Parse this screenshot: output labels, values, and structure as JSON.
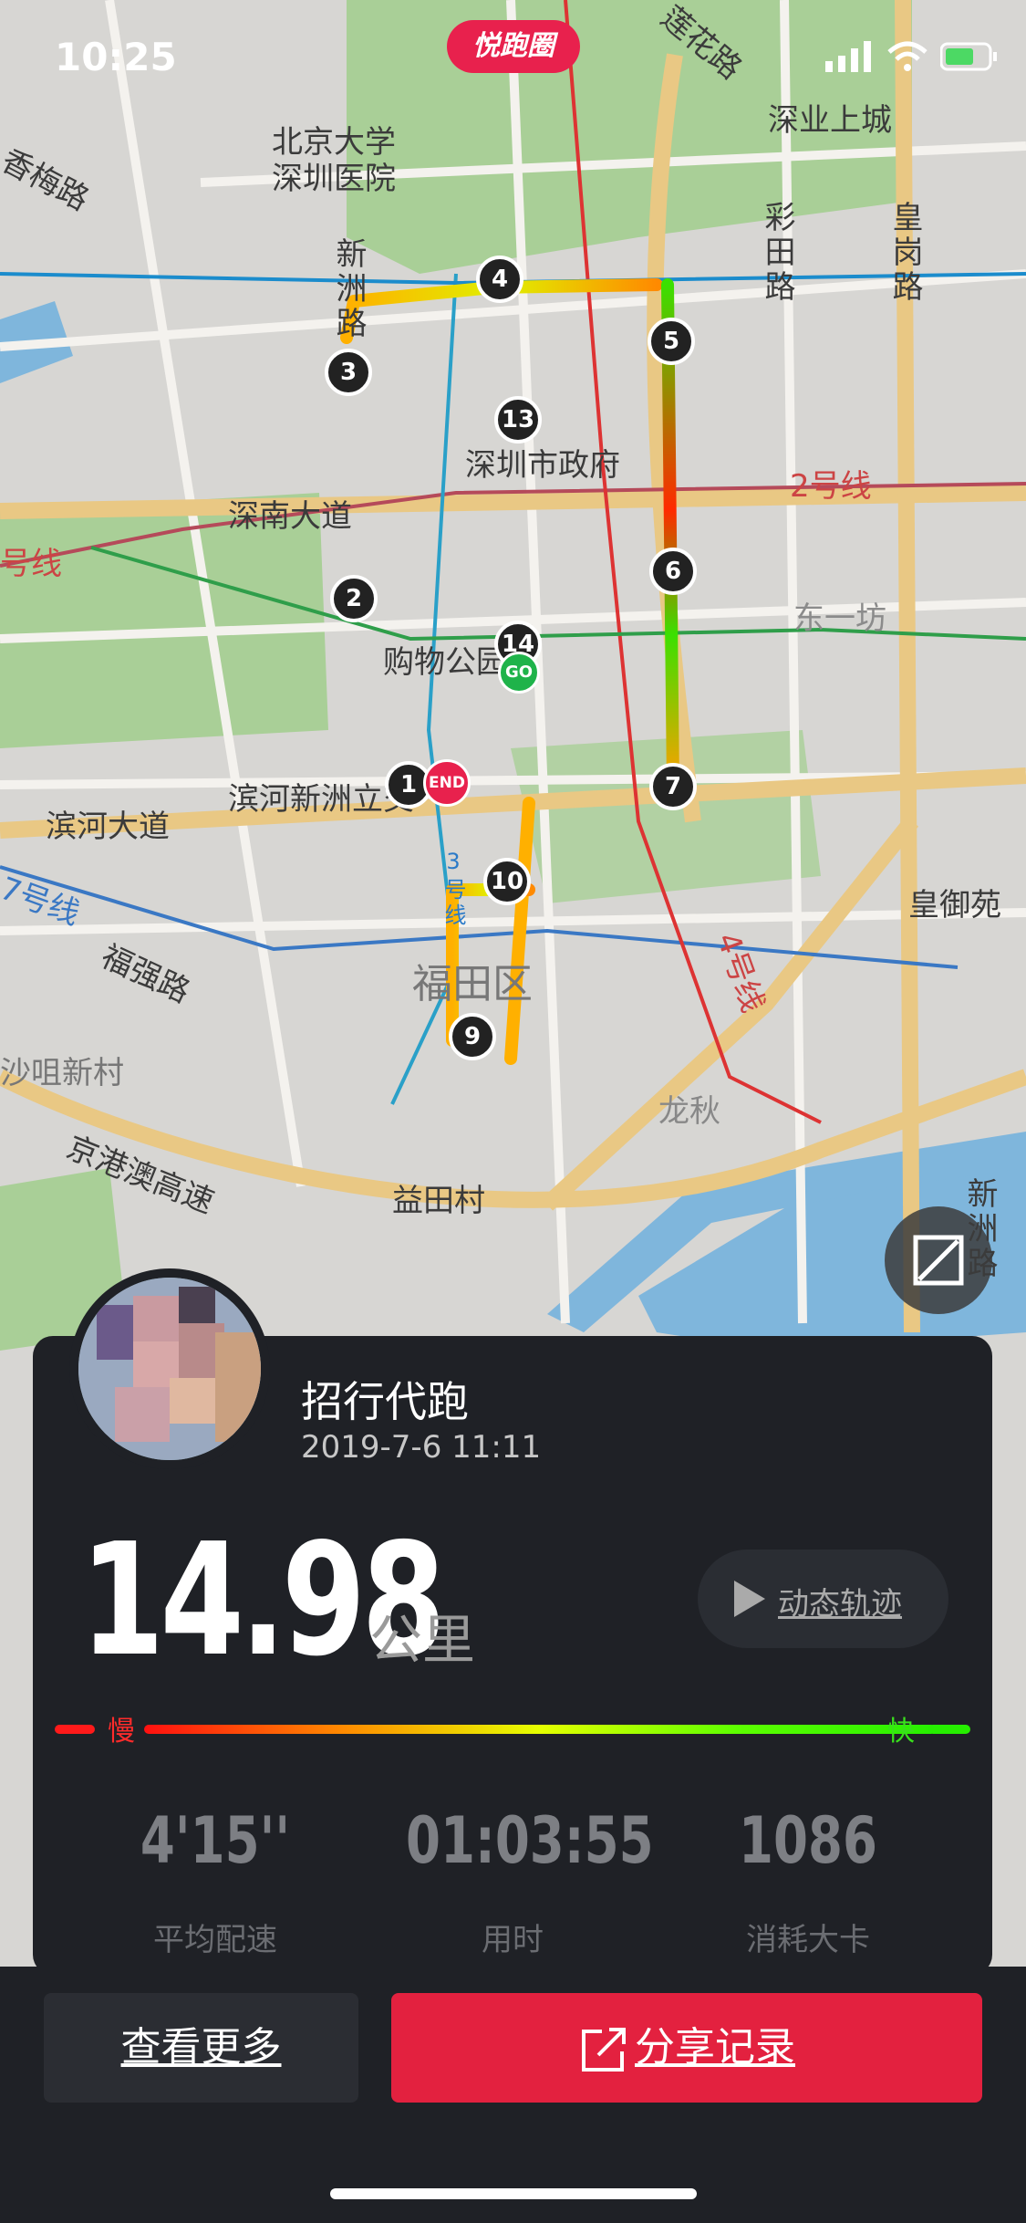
{
  "status_bar": {
    "time": "10:25"
  },
  "brand": {
    "label": "悦跑圈"
  },
  "map": {
    "labels": [
      {
        "text": "北京大学",
        "id": "map-label-pku-1"
      },
      {
        "text": "深圳医院",
        "id": "map-label-pku-2"
      },
      {
        "text": "香梅路",
        "id": "map-label-xiangmei"
      },
      {
        "text": "新洲路",
        "id": "map-label-xinzhou"
      },
      {
        "text": "莲花路",
        "id": "map-label-lianhua"
      },
      {
        "text": "深业上城",
        "id": "map-label-shenye"
      },
      {
        "text": "彩田路",
        "id": "map-label-caitian"
      },
      {
        "text": "皇岗路",
        "id": "map-label-huanggang"
      },
      {
        "text": "深圳市政府",
        "id": "map-label-gov"
      },
      {
        "text": "深南大道",
        "id": "map-label-shennan"
      },
      {
        "text": "2号线",
        "id": "map-label-line2-right"
      },
      {
        "text": "号线",
        "id": "map-label-line2-left"
      },
      {
        "text": "购物公园",
        "id": "map-label-mall"
      },
      {
        "text": "东一坊",
        "id": "map-label-dongyifang"
      },
      {
        "text": "滨河大道",
        "id": "map-label-binhe"
      },
      {
        "text": "滨河新洲立交",
        "id": "map-label-binhe-xinzhou"
      },
      {
        "text": "7号线",
        "id": "map-label-line7"
      },
      {
        "text": "福强路",
        "id": "map-label-fuqiang"
      },
      {
        "text": "福田区",
        "id": "map-label-futian"
      },
      {
        "text": "皇御苑",
        "id": "map-label-huangyu"
      },
      {
        "text": "4号线",
        "id": "map-label-line4"
      },
      {
        "text": "沙咀新村",
        "id": "map-label-shaju"
      },
      {
        "text": "龙秋",
        "id": "map-label-longqiu"
      },
      {
        "text": "京港澳高速",
        "id": "map-label-jinggangao"
      },
      {
        "text": "益田村",
        "id": "map-label-yitian"
      },
      {
        "text": "新洲路",
        "id": "map-label-xinzhou-2"
      },
      {
        "text": "3号线",
        "id": "map-label-line3"
      }
    ],
    "markers": [
      "1",
      "2",
      "3",
      "4",
      "5",
      "6",
      "7",
      "9",
      "10",
      "13",
      "14"
    ],
    "go_label": "GO",
    "end_label": "END"
  },
  "profile": {
    "username": "招行代跑",
    "datetime": "2019-7-6 11:11"
  },
  "summary": {
    "distance": "14.98",
    "distance_unit": "公里",
    "replay_label": "动态轨迹"
  },
  "speed_legend": {
    "slow": "慢",
    "fast": "快"
  },
  "stats": [
    {
      "value": "4'15''",
      "label": "平均配速"
    },
    {
      "value": "01:03:55",
      "label": "用时"
    },
    {
      "value": "1086",
      "label": "消耗大卡"
    }
  ],
  "actions": {
    "more_label": "查看更多",
    "share_label": "分享记录"
  },
  "colors": {
    "accent": "#e3213f",
    "card_bg": "#1f2126",
    "slow": "#ff1a1a",
    "fast": "#26ee00"
  }
}
